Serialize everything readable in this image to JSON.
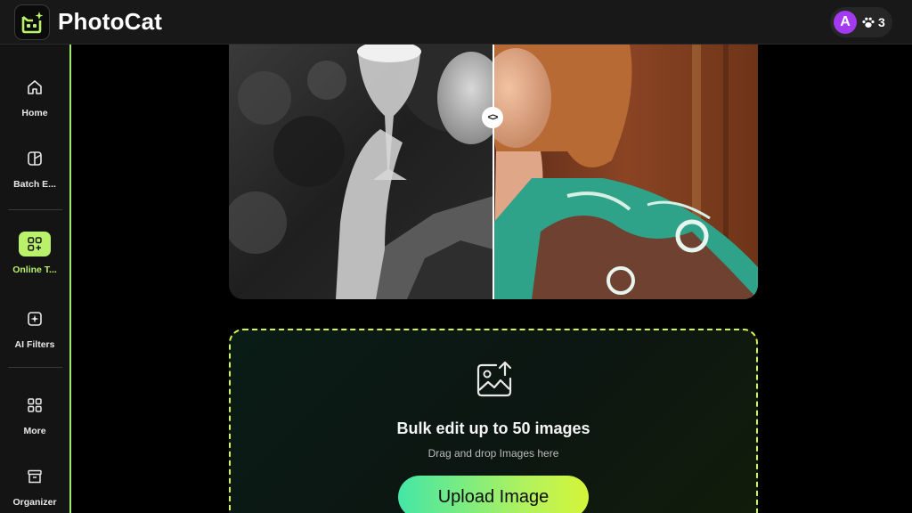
{
  "app": {
    "title": "PhotoCat"
  },
  "account": {
    "avatar_letter": "A",
    "credits": "3"
  },
  "sidebar": {
    "items": [
      {
        "label": "Home",
        "icon": "home-icon"
      },
      {
        "label": "Batch E...",
        "icon": "batch-edit-icon"
      },
      {
        "label": "Online T...",
        "icon": "online-tools-icon",
        "active": true
      },
      {
        "label": "AI Filters",
        "icon": "ai-filters-icon"
      },
      {
        "label": "More",
        "icon": "grid-icon"
      },
      {
        "label": "Organizer",
        "icon": "archive-icon"
      }
    ]
  },
  "compare": {
    "handle_glyph": "<>"
  },
  "upload": {
    "title": "Bulk edit up to 50 images",
    "hint": "Drag and drop Images here",
    "button_label": "Upload Image"
  },
  "colors": {
    "accent": "#b9f26a",
    "avatar": "#a43af0",
    "dropzone_border": "#d6f54a"
  }
}
